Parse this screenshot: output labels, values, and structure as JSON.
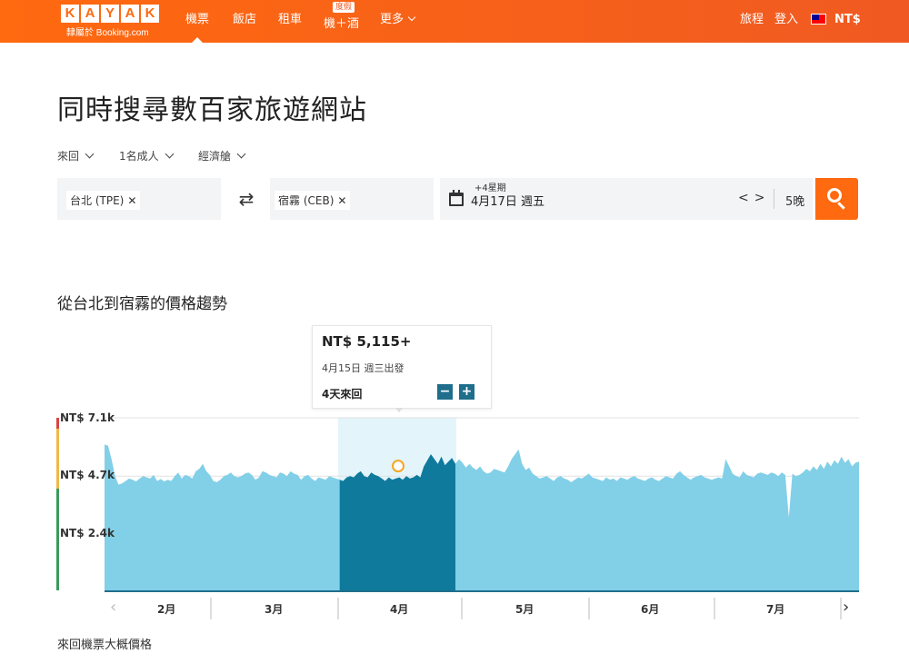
{
  "header": {
    "logo_letters": [
      "K",
      "A",
      "Y",
      "A",
      "K"
    ],
    "logo_sub": "隸屬於 Booking.com",
    "nav": [
      {
        "label": "機票",
        "active": true
      },
      {
        "label": "飯店",
        "active": false
      },
      {
        "label": "租車",
        "active": false
      },
      {
        "label": "機＋酒",
        "badge": "度假",
        "active": false
      },
      {
        "label": "更多",
        "dropdown": true,
        "active": false
      }
    ],
    "trips_label": "旅程",
    "login_label": "登入",
    "currency_label": "NT$",
    "brand_color": "#ff690f"
  },
  "page": {
    "title": "同時搜尋數百家旅遊網站"
  },
  "search": {
    "trip_type": "來回",
    "travelers": "1名成人",
    "cabin": "經濟艙",
    "origin": "台北 (TPE)",
    "destination": "宿霧 (CEB)",
    "date_flex": "+4星期",
    "date": "4月17日 週五",
    "prev_label": "<",
    "next_label": ">",
    "nights": "5晚"
  },
  "trend": {
    "title": "從台北到宿霧的價格趨勢",
    "tooltip": {
      "price": "NT$ 5,115+",
      "date": "4月15日 週三出發",
      "duration": "4天來回",
      "minus_label": "−",
      "plus_label": "+"
    },
    "footer_note": "來回機票大概價格"
  },
  "chart_data": {
    "type": "area",
    "y_tick_labels": [
      "NT$ 7.1k",
      "NT$ 4.7k",
      "NT$ 2.4k"
    ],
    "y_ticks": [
      7100,
      4700,
      2400
    ],
    "ylim": [
      0,
      7100
    ],
    "months": [
      "2月",
      "3月",
      "4月",
      "5月",
      "6月",
      "7月"
    ],
    "highlight_month": "4月",
    "selected_point": {
      "label": "4月15日",
      "value": 5115
    },
    "fill_color": "#82cfe8",
    "highlight_color": "#0f7a9c",
    "values": [
      6000,
      5950,
      5400,
      4700,
      4350,
      4400,
      4500,
      4600,
      4550,
      4480,
      4600,
      4700,
      4650,
      4600,
      4750,
      4500,
      4580,
      4480,
      4550,
      4500,
      4700,
      4850,
      4600,
      4750,
      4700,
      4600,
      4900,
      5000,
      5200,
      4900,
      4750,
      4500,
      4450,
      4550,
      4700,
      4750,
      4850,
      4700,
      4650,
      4700,
      4800,
      4850,
      4750,
      4550,
      4650,
      4900,
      4850,
      4750,
      4700,
      4650,
      4850,
      4800,
      4700,
      4900,
      4800,
      4750,
      4550,
      4700,
      4750,
      4600,
      4500,
      4650,
      4600,
      4550,
      4700,
      4650,
      4600,
      4550,
      4500,
      4650,
      4700,
      4650,
      4800,
      4900,
      4700,
      4650,
      4850,
      4750,
      4700,
      4600,
      4500,
      4650,
      4550,
      4600,
      4650,
      4550,
      4700,
      4600,
      4650,
      4750,
      4650,
      5100,
      5350,
      5600,
      5400,
      5200,
      5500,
      5150,
      5300,
      5450,
      5200,
      5400,
      5250,
      5050,
      5200,
      5050,
      4950,
      5100,
      4900,
      4800,
      4850,
      5000,
      4950,
      4900,
      4850,
      5100,
      5400,
      5600,
      5800,
      5200,
      4950,
      5050,
      4800,
      4700,
      4600,
      4650,
      4700,
      4600,
      4500,
      4650,
      4700,
      4600,
      4550,
      4450,
      4550,
      4650,
      4600,
      4700,
      4800,
      4650,
      4600,
      4550,
      4500,
      4650,
      4550,
      4600,
      4500,
      4650,
      4600,
      4550,
      4650,
      4700,
      4600,
      4550,
      4500,
      4600,
      4650,
      4550,
      4500,
      4600,
      4700,
      4650,
      4600,
      4800,
      4900,
      4750,
      4650,
      4550,
      4650,
      4700,
      4750,
      4650,
      4600,
      4550,
      4600,
      4650,
      4600,
      5400,
      5100,
      4800,
      4700,
      4650,
      4900,
      4750,
      4700,
      4650,
      4800,
      4850,
      4800,
      4750,
      4850,
      4800,
      4700,
      4850,
      4750,
      3000,
      4800,
      4700,
      4750,
      4850,
      5000,
      4900,
      5100,
      4950,
      5200,
      5000,
      5300,
      5100,
      5350,
      5200,
      5500,
      5250,
      5400,
      5100,
      5250,
      5300
    ]
  }
}
